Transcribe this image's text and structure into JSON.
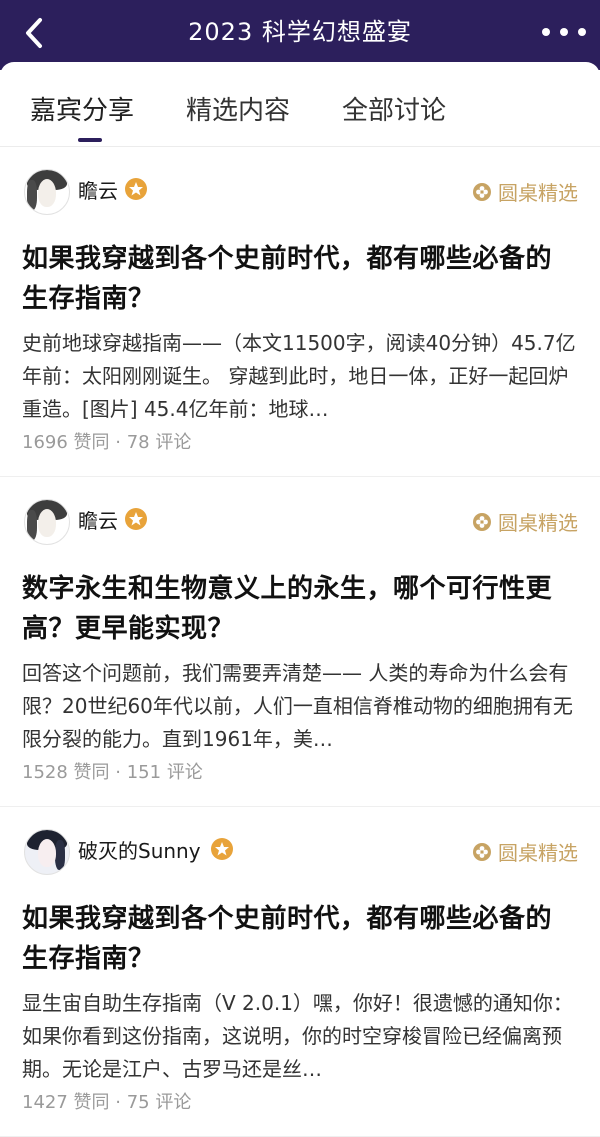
{
  "header": {
    "title": "2023 科学幻想盛宴"
  },
  "tabs": [
    {
      "label": "嘉宾分享",
      "active": true
    },
    {
      "label": "精选内容",
      "active": false
    },
    {
      "label": "全部讨论",
      "active": false
    }
  ],
  "colors": {
    "header_bg": "#2c1f5c",
    "badge_gold": "#e8a33a",
    "featured_gold": "#c7a363"
  },
  "posts": [
    {
      "author": "瞻云",
      "featured_label": "圆桌精选",
      "title": "如果我穿越到各个史前时代，都有哪些必备的生存指南？",
      "excerpt": "史前地球穿越指南——（本文11500字，阅读40分钟）45.7亿年前：太阳刚刚诞生。 穿越到此时，地日一体，正好一起回炉重造。[图片] 45.4亿年前：地球…",
      "likes": "1696 赞同",
      "dot": "·",
      "comments": "78 评论"
    },
    {
      "author": "瞻云",
      "featured_label": "圆桌精选",
      "title": "数字永生和生物意义上的永生，哪个可行性更高？更早能实现？",
      "excerpt": "回答这个问题前，我们需要弄清楚—— 人类的寿命为什么会有限？20世纪60年代以前，人们一直相信脊椎动物的细胞拥有无限分裂的能力。直到1961年，美…",
      "likes": "1528 赞同",
      "dot": "·",
      "comments": "151 评论"
    },
    {
      "author": "破灭的Sunny",
      "featured_label": "圆桌精选",
      "title": "如果我穿越到各个史前时代，都有哪些必备的生存指南？",
      "excerpt": "显生宙自助生存指南（V 2.0.1）嘿，你好！很遗憾的通知你： 如果你看到这份指南，这说明，你的时空穿梭冒险已经偏离预期。无论是江户、古罗马还是丝…",
      "likes": "1427 赞同",
      "dot": "·",
      "comments": "75 评论"
    }
  ]
}
